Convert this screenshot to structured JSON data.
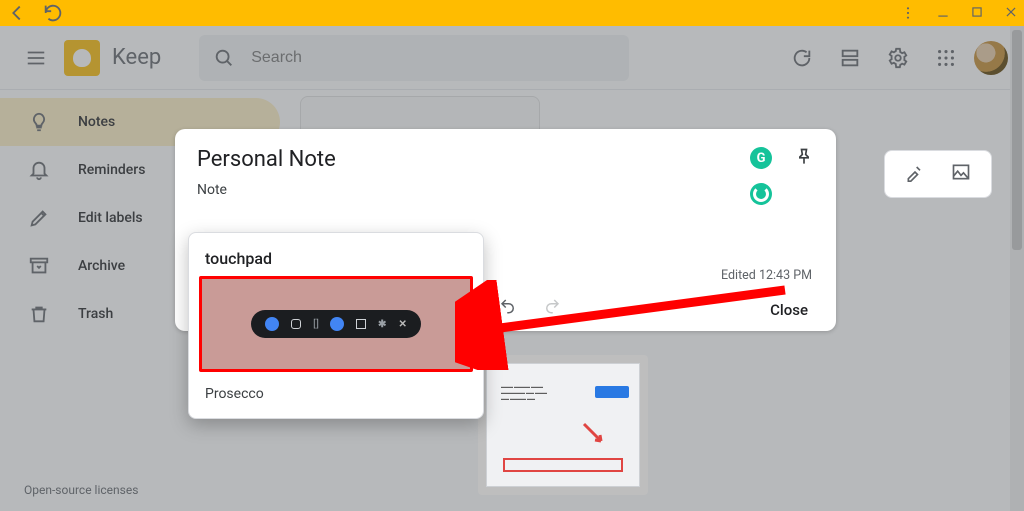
{
  "titlebar": {
    "nav": {
      "back": "back",
      "reload": "reload"
    },
    "sys": {
      "more": "more",
      "min": "minimize",
      "max": "maximize",
      "close": "close"
    }
  },
  "header": {
    "app_name": "Keep",
    "search_placeholder": "Search"
  },
  "sidebar": {
    "items": [
      {
        "label": "Notes"
      },
      {
        "label": "Reminders"
      },
      {
        "label": "Edit labels"
      },
      {
        "label": "Archive"
      },
      {
        "label": "Trash"
      }
    ],
    "footer": "Open-source licenses"
  },
  "modal": {
    "title": "Personal Note",
    "body": "Note",
    "edited": "Edited 12:43 PM",
    "close": "Close"
  },
  "pasted": {
    "title": "touchpad",
    "footer": "Prosecco"
  },
  "grammarly_letter": "G"
}
